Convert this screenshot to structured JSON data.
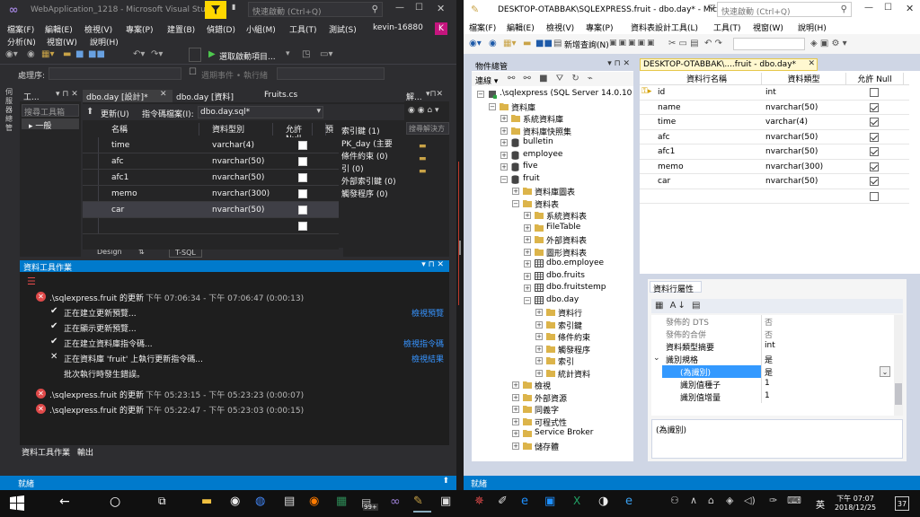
{
  "left": {
    "title": "WebApplication_1218 - Microsoft Visual Stu...",
    "search_placeholder": "快速啟動 (Ctrl+Q)",
    "menu": [
      "檔案(F)",
      "編輯(E)",
      "檢視(V)",
      "專案(P)",
      "建置(B)",
      "偵錯(D)",
      "小組(M)",
      "工具(T)",
      "測試(S)",
      "分析(N)",
      "視窗(W)",
      "說明(H)"
    ],
    "user": "kevin-16880",
    "user_initial": "K",
    "run_label": "選取啟動項目...",
    "tool2_label": "處理序:",
    "tool2_events": "週期事件 • 執行緒",
    "sidebar_vertical": "伺服器總管",
    "toolbox_title": "工...",
    "toolbox_search": "搜尋工具箱",
    "toolbox_group": "▸ 一般",
    "tabs": [
      "dbo.day [設計]*",
      "dbo.day [資料]",
      "Fruits.cs"
    ],
    "update_label": "更新(U)",
    "script_label": "指令碼檔案(I):",
    "script_file": "dbo.day.sql*",
    "grid_headers": [
      "名稱",
      "資料型別",
      "允許 Null",
      "預"
    ],
    "grid_rows": [
      {
        "name": "time",
        "type": "varchar(4)",
        "null": true
      },
      {
        "name": "afc",
        "type": "nvarchar(50)",
        "null": true
      },
      {
        "name": "afc1",
        "type": "nvarchar(50)",
        "null": true
      },
      {
        "name": "memo",
        "type": "nvarchar(300)",
        "null": true
      },
      {
        "name": "car",
        "type": "nvarchar(50)",
        "null": true
      },
      {
        "name": "",
        "type": "",
        "null": false
      }
    ],
    "keys_lines": [
      "索引鍵 (1)",
      "PK_day (主要",
      "條件約束 (0)",
      "引 (0)",
      "外部索引鍵 (0)",
      "觸發程序 (0)"
    ],
    "design_tab": "Design",
    "tsql_tab": "T-SQL",
    "sol_title": "解...",
    "sol_search": "搜尋解決方",
    "out_title": "資料工具作業",
    "out_items": [
      {
        "icon": "error",
        "text": ".\\sqlexpress.fruit 的更新",
        "time": "下午 07:06:34 - 下午 07:06:47 (0:00:13)",
        "link": ""
      },
      {
        "icon": "ok",
        "text": "正在建立更新預覽...",
        "time": "",
        "link": "檢視預覽"
      },
      {
        "icon": "ok",
        "text": "正在顯示更新預覽...",
        "time": "",
        "link": ""
      },
      {
        "icon": "ok",
        "text": "正在建立資料庫指令碼...",
        "time": "",
        "link": "檢視指令碼"
      },
      {
        "icon": "x",
        "text": "正在資料庫 'fruit' 上執行更新指令碼...",
        "time": "",
        "link": "檢視結果"
      },
      {
        "icon": "none",
        "text": "批次執行時發生錯誤。",
        "time": "",
        "link": ""
      },
      {
        "icon": "error",
        "text": ".\\sqlexpress.fruit 的更新",
        "time": "下午 05:23:15 - 下午 05:23:23 (0:00:07)",
        "link": ""
      },
      {
        "icon": "error",
        "text": ".\\sqlexpress.fruit 的更新",
        "time": "下午 05:22:47 - 下午 05:23:03 (0:00:15)",
        "link": ""
      }
    ],
    "bottom_tabs": [
      "資料工具作業",
      "輸出"
    ],
    "status": "就緒"
  },
  "right": {
    "title": "DESKTOP-OTABBAK\\SQLEXPRESS.fruit - dbo.day* - Mic...",
    "search_placeholder": "快速啟動 (Ctrl+Q)",
    "menu": [
      "檔案(F)",
      "編輯(E)",
      "檢視(V)",
      "專案(P)",
      "資料表設計工具(L)",
      "工具(T)",
      "視窗(W)",
      "說明(H)"
    ],
    "new_query": "新增查詢(N)",
    "oe_title": "物件總管",
    "oe_connect": "連線 ▾",
    "tree": [
      {
        "d": 0,
        "e": "-",
        "icon": "server",
        "t": ".\\sqlexpress (SQL Server 14.0.10"
      },
      {
        "d": 1,
        "e": "-",
        "icon": "folder",
        "t": "資料庫"
      },
      {
        "d": 2,
        "e": "+",
        "icon": "folder",
        "t": "系統資料庫"
      },
      {
        "d": 2,
        "e": "+",
        "icon": "folder",
        "t": "資料庫快照集"
      },
      {
        "d": 2,
        "e": "+",
        "icon": "db",
        "t": "bulletin"
      },
      {
        "d": 2,
        "e": "+",
        "icon": "db",
        "t": "employee"
      },
      {
        "d": 2,
        "e": "+",
        "icon": "db",
        "t": "five"
      },
      {
        "d": 2,
        "e": "-",
        "icon": "db",
        "t": "fruit"
      },
      {
        "d": 3,
        "e": "+",
        "icon": "folder",
        "t": "資料庫圖表"
      },
      {
        "d": 3,
        "e": "-",
        "icon": "folder",
        "t": "資料表"
      },
      {
        "d": 4,
        "e": "+",
        "icon": "folder",
        "t": "系統資料表"
      },
      {
        "d": 4,
        "e": "+",
        "icon": "folder",
        "t": "FileTable"
      },
      {
        "d": 4,
        "e": "+",
        "icon": "folder",
        "t": "外部資料表"
      },
      {
        "d": 4,
        "e": "+",
        "icon": "folder",
        "t": "圖形資料表"
      },
      {
        "d": 4,
        "e": "+",
        "icon": "table",
        "t": "dbo.employee"
      },
      {
        "d": 4,
        "e": "+",
        "icon": "table",
        "t": "dbo.fruits"
      },
      {
        "d": 4,
        "e": "+",
        "icon": "table",
        "t": "dbo.fruitstemp"
      },
      {
        "d": 4,
        "e": "-",
        "icon": "table",
        "t": "dbo.day"
      },
      {
        "d": 5,
        "e": "+",
        "icon": "folder",
        "t": "資料行"
      },
      {
        "d": 5,
        "e": "+",
        "icon": "folder",
        "t": "索引鍵"
      },
      {
        "d": 5,
        "e": "+",
        "icon": "folder",
        "t": "條件約束"
      },
      {
        "d": 5,
        "e": "+",
        "icon": "folder",
        "t": "觸發程序"
      },
      {
        "d": 5,
        "e": "+",
        "icon": "folder",
        "t": "索引"
      },
      {
        "d": 5,
        "e": "+",
        "icon": "folder",
        "t": "統計資料"
      },
      {
        "d": 3,
        "e": "+",
        "icon": "folder",
        "t": "檢視"
      },
      {
        "d": 3,
        "e": "+",
        "icon": "folder",
        "t": "外部資源"
      },
      {
        "d": 3,
        "e": "+",
        "icon": "folder",
        "t": "同義字"
      },
      {
        "d": 3,
        "e": "+",
        "icon": "folder",
        "t": "可程式性"
      },
      {
        "d": 3,
        "e": "+",
        "icon": "folder",
        "t": "Service Broker"
      },
      {
        "d": 3,
        "e": "+",
        "icon": "folder",
        "t": "儲存體"
      }
    ],
    "doc_tab": "DESKTOP-OTABBAK\\....fruit - dbo.day*",
    "grid_headers": [
      "資料行名稱",
      "資料類型",
      "允許 Null"
    ],
    "grid_rows": [
      {
        "name": "id",
        "type": "int",
        "null": false,
        "key": true
      },
      {
        "name": "name",
        "type": "nvarchar(50)",
        "null": true,
        "key": false
      },
      {
        "name": "time",
        "type": "varchar(4)",
        "null": true,
        "key": false
      },
      {
        "name": "afc",
        "type": "nvarchar(50)",
        "null": true,
        "key": false
      },
      {
        "name": "afc1",
        "type": "nvarchar(50)",
        "null": true,
        "key": false
      },
      {
        "name": "memo",
        "type": "nvarchar(300)",
        "null": true,
        "key": false
      },
      {
        "name": "car",
        "type": "nvarchar(50)",
        "null": true,
        "key": false
      },
      {
        "name": "",
        "type": "",
        "null": false,
        "key": false
      }
    ],
    "prop_tab": "資料行屬性",
    "props": [
      {
        "k": "發佈的 DTS",
        "v": "否",
        "dim": true
      },
      {
        "k": "發佈的合併",
        "v": "否",
        "dim": true
      },
      {
        "k": "資料類型摘要",
        "v": "int",
        "dim": false
      },
      {
        "k": "識別規格",
        "v": "是",
        "dim": false,
        "group": true
      },
      {
        "k": "(為識別)",
        "v": "是",
        "dim": false,
        "sel": true
      },
      {
        "k": "識別值種子",
        "v": "1",
        "dim": false
      },
      {
        "k": "識別值增量",
        "v": "1",
        "dim": false
      }
    ],
    "prop_desc": "(為識別)",
    "status": "就緒"
  },
  "taskbar": {
    "lang": "英",
    "time": "下午 07:07",
    "date": "2018/12/25",
    "notif_count": "37",
    "badge": "99+"
  }
}
